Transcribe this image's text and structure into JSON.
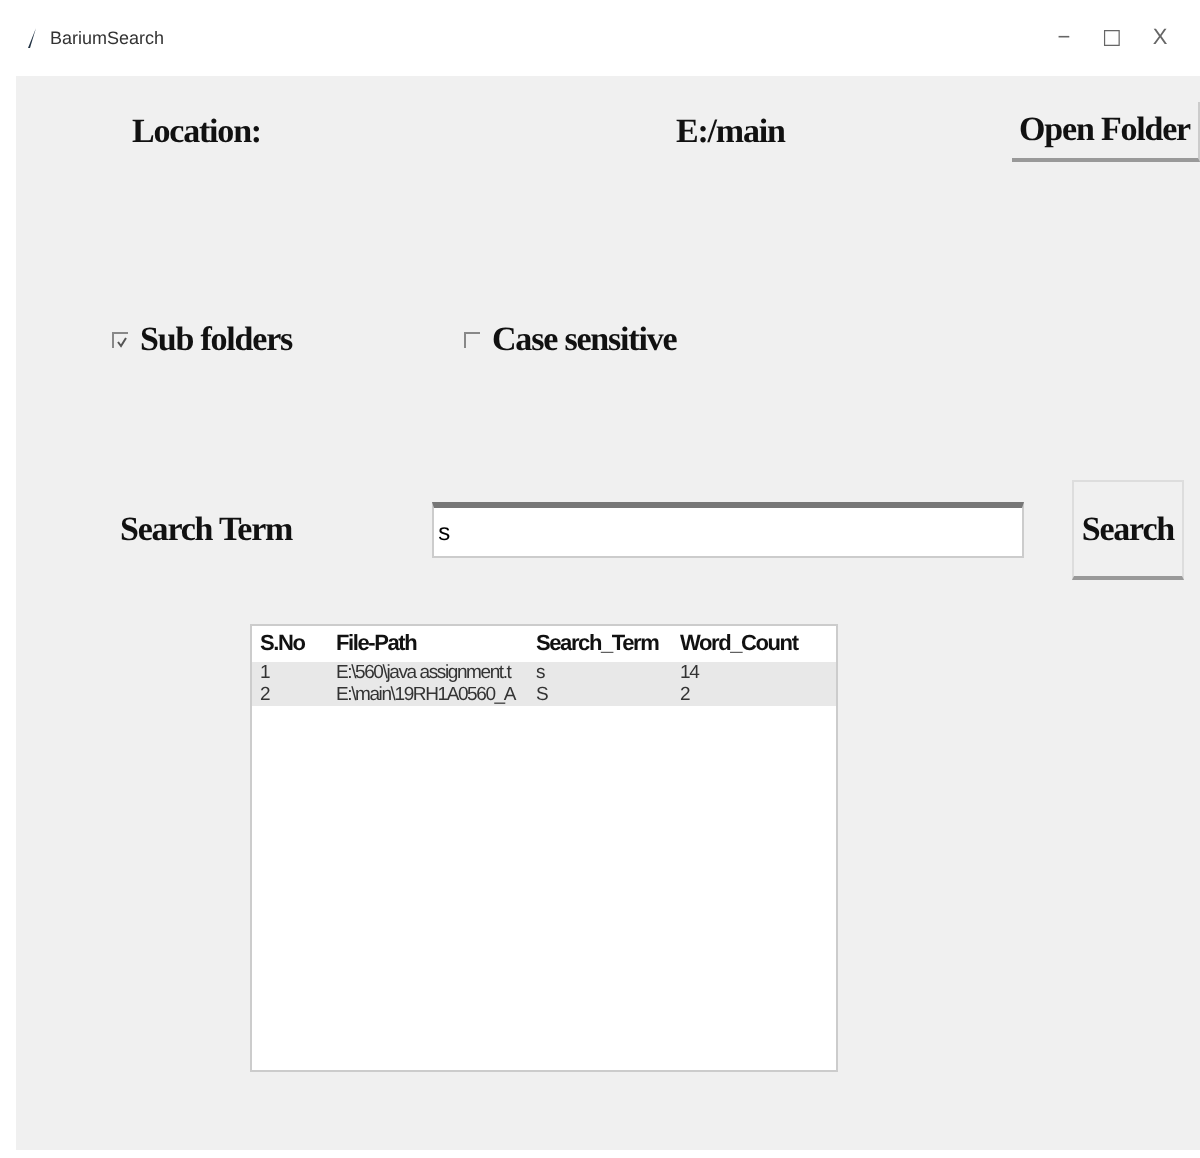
{
  "window": {
    "title": "BariumSearch",
    "controls": [
      "−",
      "☐",
      "X"
    ]
  },
  "location": {
    "label": "Location:",
    "value": "E:/main",
    "button": "Open Folder"
  },
  "options": [
    {
      "label": "Sub folders",
      "checked": true
    },
    {
      "label": "Case sensitive",
      "checked": false
    }
  ],
  "search": {
    "label": "Search Term",
    "value": "s",
    "button": "Search"
  },
  "table": {
    "columns": [
      "S.No",
      "File-Path",
      "Search_Term",
      "Word_Count"
    ],
    "rows": [
      {
        "cells": [
          "1",
          "E:\\560\\java assignment.t",
          "s",
          "14"
        ],
        "selected": true
      },
      {
        "cells": [
          "2",
          "E:\\main\\19RH1A0560_A",
          "S",
          "2"
        ],
        "selected": true
      }
    ]
  }
}
